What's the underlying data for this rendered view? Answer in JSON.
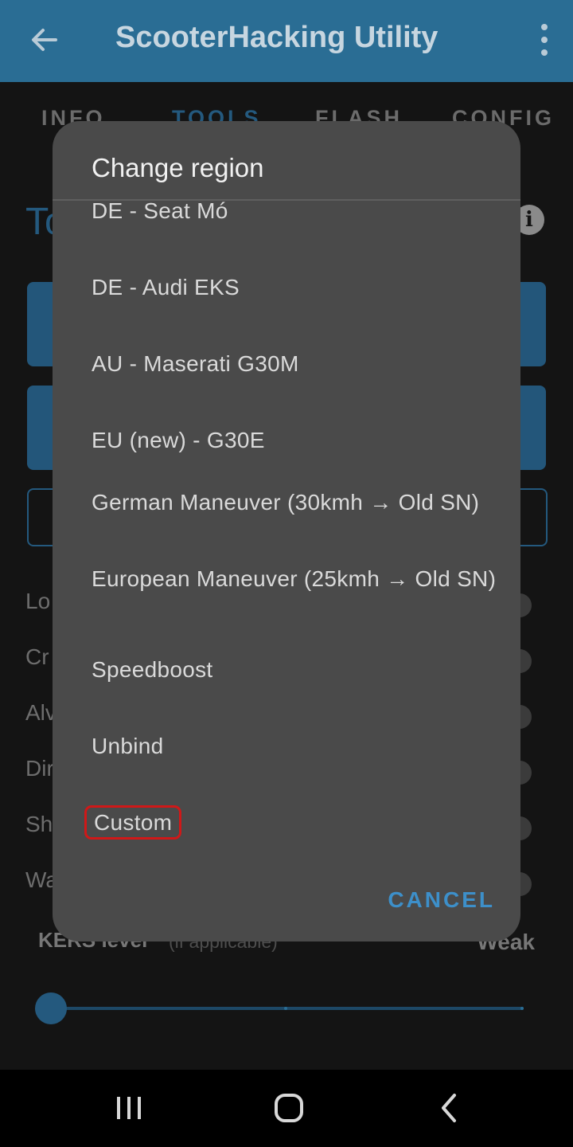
{
  "app": {
    "title": "ScooterHacking Utility"
  },
  "tabs": [
    {
      "label": "INFO"
    },
    {
      "label": "TOOLS"
    },
    {
      "label": "FLASH"
    },
    {
      "label": "CONFIG"
    }
  ],
  "background": {
    "heading": "To",
    "options": [
      {
        "label": "Lo"
      },
      {
        "label": "Cr"
      },
      {
        "label": "Alv"
      },
      {
        "label": "Dir"
      },
      {
        "label": "Sh"
      },
      {
        "label": "Wa"
      }
    ],
    "kers": {
      "label": "KERS level",
      "note": "(if applicable)",
      "value": "Weak"
    }
  },
  "dialog": {
    "title": "Change region",
    "items": [
      {
        "label": "DE - Seat Mó"
      },
      {
        "label": "DE - Audi EKS"
      },
      {
        "label": "AU - Maserati G30M"
      },
      {
        "label": "EU (new) - G30E"
      },
      {
        "label": "German Maneuver (30kmh → Old SN)"
      },
      {
        "label": "European Maneuver (25kmh → Old SN)"
      },
      {
        "label": "Speedboost"
      },
      {
        "label": "Unbind"
      },
      {
        "label": "Custom"
      }
    ],
    "cancel_label": "CANCEL"
  },
  "colors": {
    "appbar": "#2a6d94",
    "accent": "#3d8fc9",
    "dialog_bg": "#4a4a4a",
    "highlight": "#d01818"
  }
}
